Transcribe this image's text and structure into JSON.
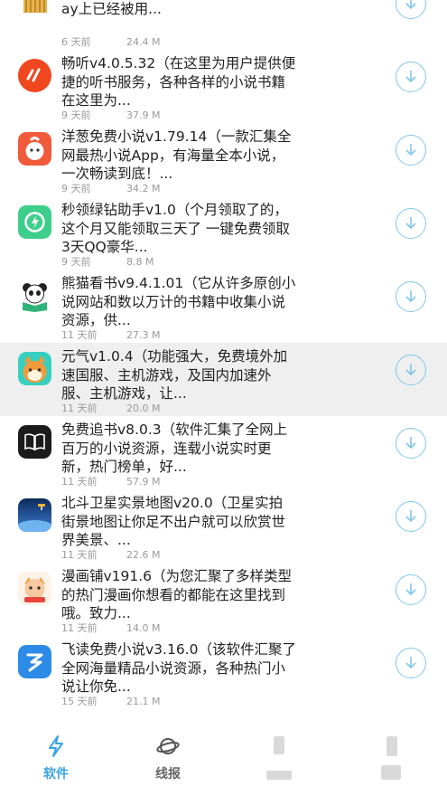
{
  "apps": [
    {
      "title": "手机系统垃圾清除工具，在Google Play上已经被用...",
      "date": "6 天前",
      "size": "24.4 M",
      "icon": "broom-icon",
      "color": "#e8b34a"
    },
    {
      "title": "畅听v4.0.5.32（在这里为用户提供便捷的听书服务，各种各样的小说书籍在这里为...",
      "date": "9 天前",
      "size": "37.9 M",
      "icon": "changting-logo-icon",
      "color": "#f0471f"
    },
    {
      "title": "洋葱免费小说v1.79.14（一款汇集全网最热小说App，有海量全本小说，一次畅读到底！...",
      "date": "9 天前",
      "size": "34.2 M",
      "icon": "onion-mascot-icon",
      "color": "#f15a3a"
    },
    {
      "title": "秒领绿钻助手v1.0（个月领取了的，这个月又能领取三天了 一键免费领取3天QQ豪华...",
      "date": "9 天前",
      "size": "8.8 M",
      "icon": "green-diamond-icon",
      "color": "#3dcf8a"
    },
    {
      "title": "熊猫看书v9.4.1.01（它从许多原创小说网站和数以万计的书籍中收集小说资源，供...",
      "date": "11 天前",
      "size": "27.3 M",
      "icon": "panda-book-icon",
      "color": "#2fb37a"
    },
    {
      "title": "元气v1.0.4（功能强大，免费境外加速国服、主机游戏，及国内加速外服、主机游戏，让...",
      "date": "11 天前",
      "size": "20.0 M",
      "icon": "fox-mascot-icon",
      "color": "#f39a3a"
    },
    {
      "title": "免费追书v8.0.3（软件汇集了全网上百万的小说资源，连载小说实时更新，热门榜单，好...",
      "date": "11 天前",
      "size": "57.9 M",
      "icon": "open-book-icon",
      "color": "#1b1b1b"
    },
    {
      "title": "北斗卫星实景地图v20.0（卫星实拍街景地图让你足不出户就可以欣赏世界美景、...",
      "date": "11 天前",
      "size": "22.6 M",
      "icon": "satellite-earth-icon",
      "color": "#1f4fa0"
    },
    {
      "title": "漫画铺v191.6（为您汇聚了多样类型的热门漫画你想看的都能在这里找到哦。致力...",
      "date": "11 天前",
      "size": "14.0 M",
      "icon": "comic-mascot-icon",
      "color": "#f8c9a0"
    },
    {
      "title": "飞读免费小说v3.16.0（该软件汇聚了全网海量精品小说资源，各种热门小说让你免...",
      "date": "15 天前",
      "size": "21.1 M",
      "icon": "feidu-logo-icon",
      "color": "#2b8be6"
    }
  ],
  "tabs": [
    {
      "label": "软件",
      "icon": "lightning-icon"
    },
    {
      "label": "线报",
      "icon": "planet-icon"
    },
    {
      "label": "",
      "icon": "blurred-icon"
    },
    {
      "label": "",
      "icon": "blurred-icon"
    }
  ],
  "colors": {
    "accent": "#3aa3e3",
    "download_ring": "#7fc7ea",
    "highlight_row": "#efefef"
  }
}
